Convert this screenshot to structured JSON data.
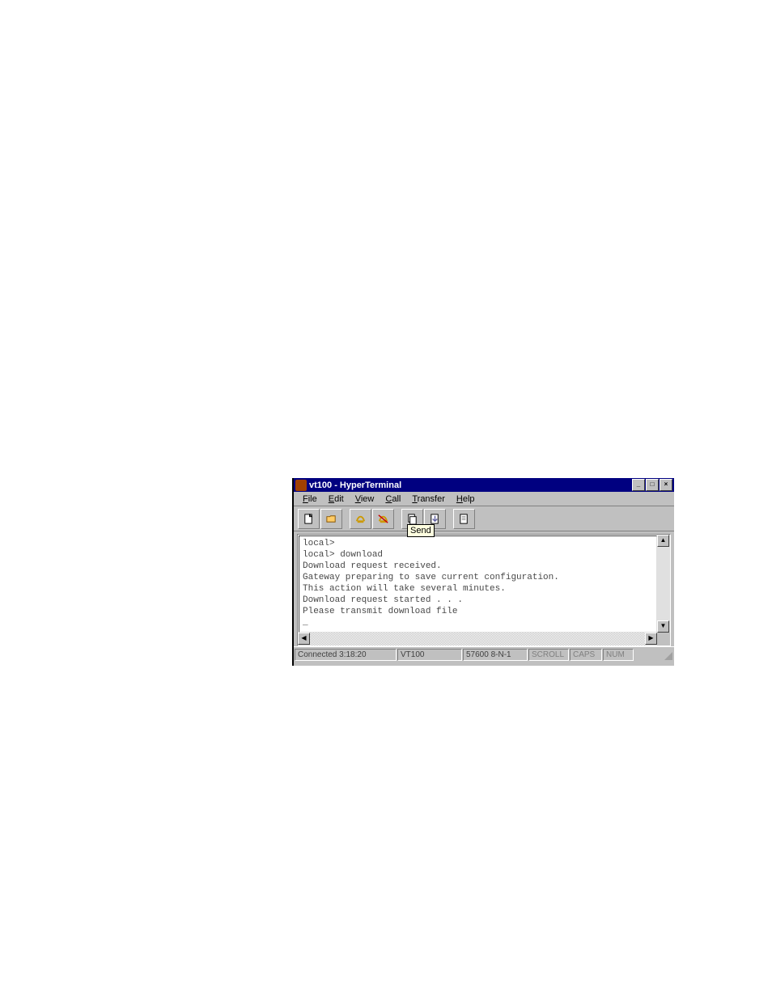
{
  "window": {
    "title": "vt100 - HyperTerminal"
  },
  "menubar": {
    "file": "File",
    "edit": "Edit",
    "view": "View",
    "call": "Call",
    "transfer": "Transfer",
    "help": "Help"
  },
  "toolbar": {
    "tooltip_send": "Send"
  },
  "terminal": {
    "line1": "local>",
    "line2": "local> download",
    "line3": "Download request received.",
    "line4": "Gateway preparing to save current configuration.",
    "line5": "This action will take several minutes.",
    "line6": "Download request started . . .",
    "line7": "Please transmit download file",
    "line8": "_"
  },
  "statusbar": {
    "connected": "Connected 3:18:20",
    "emulation": "VT100",
    "comm": "57600 8-N-1",
    "scroll": "SCROLL",
    "caps": "CAPS",
    "num": "NUM"
  }
}
